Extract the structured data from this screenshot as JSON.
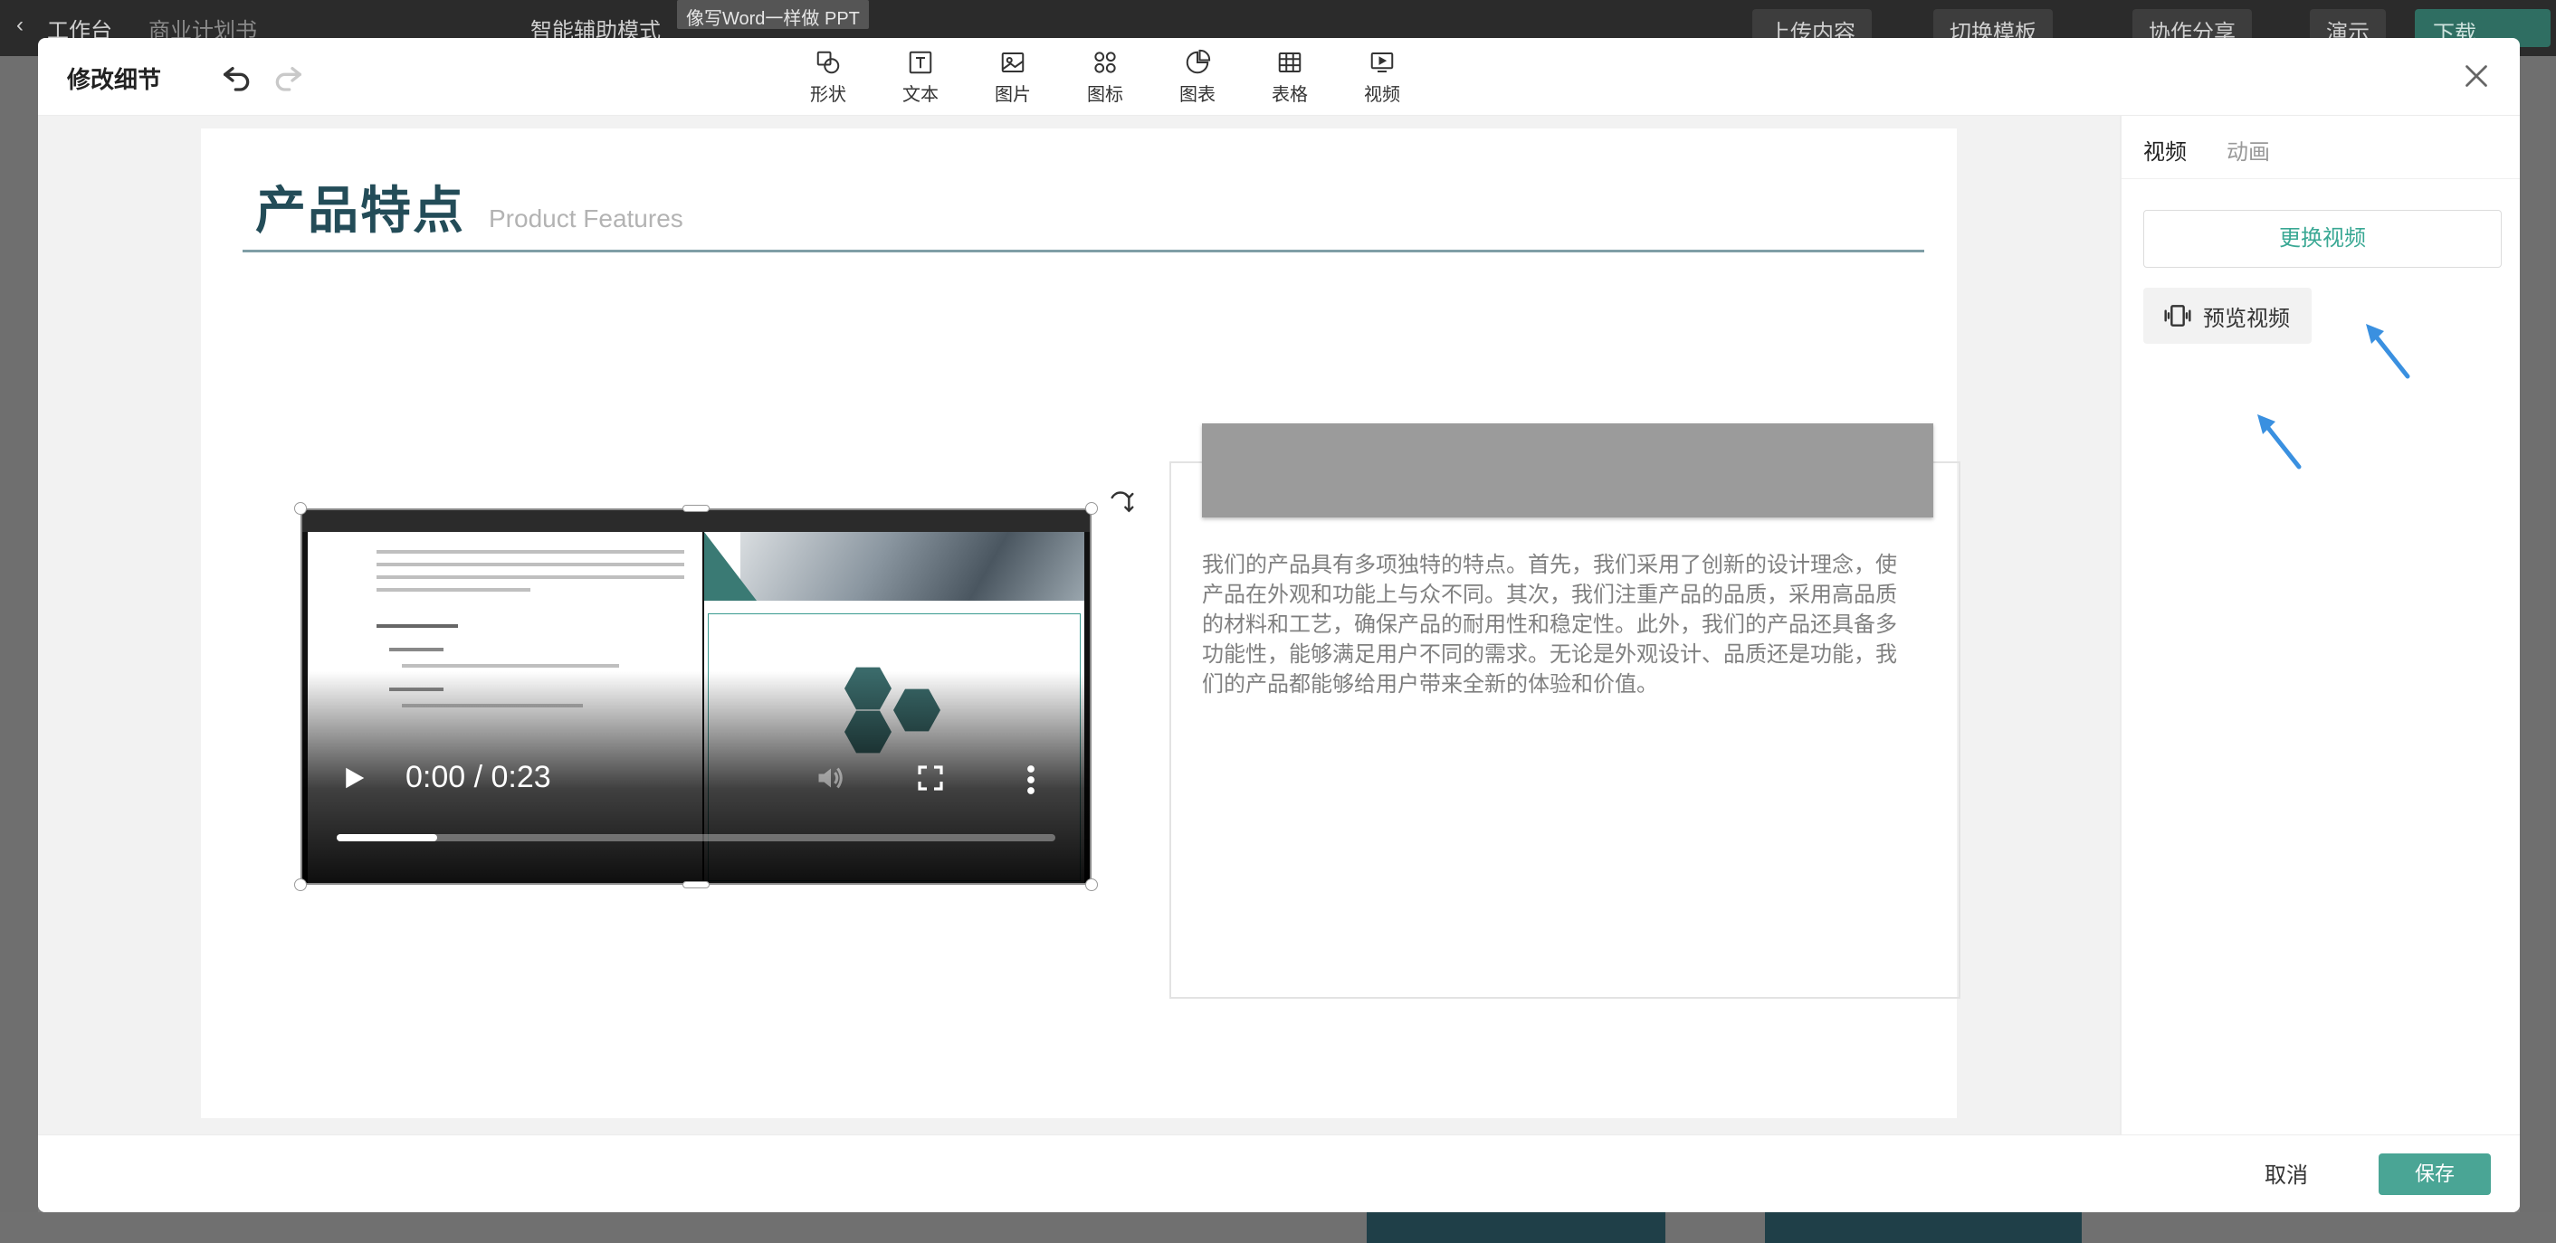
{
  "background": {
    "workspace_label": "工作台",
    "doc_name": "商业计划书",
    "mode_label": "智能辅助模式",
    "tooltip": "像写Word一样做 PPT",
    "upload": "上传内容",
    "switch_template": "切换模板",
    "share": "协作分享",
    "present": "演示",
    "download": "下载"
  },
  "modal": {
    "title": "修改细节",
    "tools": [
      {
        "label": "形状",
        "icon": "shape-icon"
      },
      {
        "label": "文本",
        "icon": "text-icon"
      },
      {
        "label": "图片",
        "icon": "image-icon"
      },
      {
        "label": "图标",
        "icon": "icon-library-icon"
      },
      {
        "label": "图表",
        "icon": "chart-icon"
      },
      {
        "label": "表格",
        "icon": "table-icon"
      },
      {
        "label": "视频",
        "icon": "video-icon"
      }
    ]
  },
  "slide": {
    "title": "产品特点",
    "subtitle": "Product Features",
    "body": "我们的产品具有多项独特的特点。首先，我们采用了创新的设计理念，使产品在外观和功能上与众不同。其次，我们注重产品的品质，采用高品质的材料和工艺，确保产品的耐用性和稳定性。此外，我们的产品还具备多功能性，能够满足用户不同的需求。无论是外观设计、品质还是功能，我们的产品都能够给用户带来全新的体验和价值。"
  },
  "video": {
    "time": "0:00 / 0:23",
    "progress_fraction": 0.14
  },
  "panel": {
    "tabs": [
      "视频",
      "动画"
    ],
    "replace_video": "更换视频",
    "preview_video": "预览视频"
  },
  "footer": {
    "cancel": "取消",
    "save": "保存"
  },
  "colors": {
    "accent": "#4aa595",
    "title": "#234c58"
  }
}
